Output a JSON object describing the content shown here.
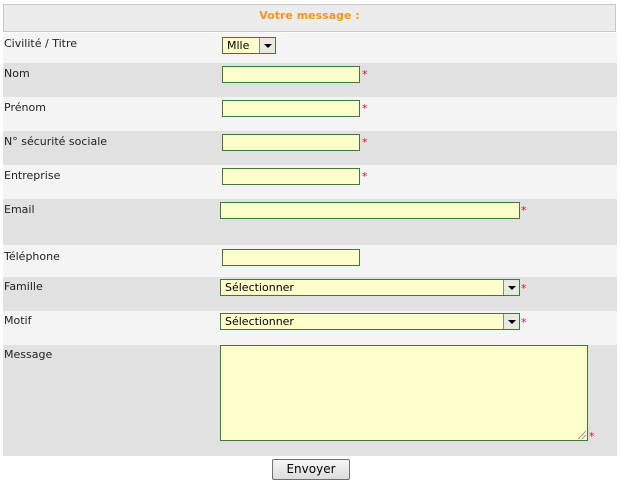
{
  "form": {
    "heading": "Votre message :",
    "required_mark": "*",
    "submit_label": "Envoyer"
  },
  "fields": {
    "civilite": {
      "label": "Civilité / Titre",
      "value": "Mlle"
    },
    "nom": {
      "label": "Nom",
      "value": ""
    },
    "prenom": {
      "label": "Prénom",
      "value": ""
    },
    "secu": {
      "label": "N° sécurité sociale",
      "value": ""
    },
    "entreprise": {
      "label": "Entreprise",
      "value": ""
    },
    "email": {
      "label": "Email",
      "value": ""
    },
    "telephone": {
      "label": "Téléphone",
      "value": ""
    },
    "famille": {
      "label": "Famille",
      "value": "Sélectionner"
    },
    "motif": {
      "label": "Motif",
      "value": "Sélectionner"
    },
    "message": {
      "label": "Message",
      "value": ""
    }
  },
  "colors": {
    "heading": "#f7941d",
    "field_background": "#ffffcc",
    "field_border": "#3b7a3b",
    "required": "#e0102a",
    "row_light": "#f4f4f4",
    "row_dark": "#e1e1e1"
  },
  "icons": {
    "dropdown": "chevron-down-icon",
    "resize": "resize-grip-icon"
  }
}
